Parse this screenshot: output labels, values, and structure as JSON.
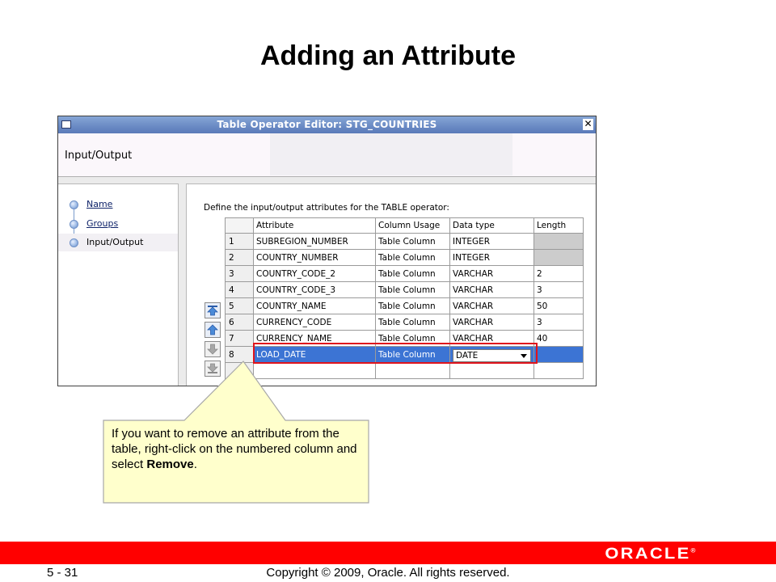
{
  "slide": {
    "title": "Adding an Attribute"
  },
  "window": {
    "title": "Table Operator Editor: STG_COUNTRIES",
    "close_glyph": "✕",
    "header_title": "Input/Output"
  },
  "nav": {
    "items": [
      {
        "label": "Name",
        "active": false
      },
      {
        "label": "Groups",
        "active": false
      },
      {
        "label": "Input/Output",
        "active": true
      }
    ]
  },
  "content": {
    "instruction": "Define the input/output attributes for the TABLE operator:",
    "columns": [
      "Attribute",
      "Column Usage",
      "Data type",
      "Length"
    ],
    "rows": [
      {
        "num": "1",
        "attribute": "SUBREGION_NUMBER",
        "usage": "Table Column",
        "type": "INTEGER",
        "length": ""
      },
      {
        "num": "2",
        "attribute": "COUNTRY_NUMBER",
        "usage": "Table Column",
        "type": "INTEGER",
        "length": ""
      },
      {
        "num": "3",
        "attribute": "COUNTRY_CODE_2",
        "usage": "Table Column",
        "type": "VARCHAR",
        "length": "2"
      },
      {
        "num": "4",
        "attribute": "COUNTRY_CODE_3",
        "usage": "Table Column",
        "type": "VARCHAR",
        "length": "3"
      },
      {
        "num": "5",
        "attribute": "COUNTRY_NAME",
        "usage": "Table Column",
        "type": "VARCHAR",
        "length": "50"
      },
      {
        "num": "6",
        "attribute": "CURRENCY_CODE",
        "usage": "Table Column",
        "type": "VARCHAR",
        "length": "3"
      },
      {
        "num": "7",
        "attribute": "CURRENCY_NAME",
        "usage": "Table Column",
        "type": "VARCHAR",
        "length": "40"
      },
      {
        "num": "8",
        "attribute": "LOAD_DATE",
        "usage": "Table Column",
        "type": "DATE",
        "length": ""
      }
    ],
    "selected_row": "8"
  },
  "callout": {
    "text_before": "If you want to remove an attribute from the table, right-click on the numbered column and select ",
    "bold_word": "Remove",
    "text_after": "."
  },
  "footer": {
    "page": "5 - 31",
    "copyright": "Copyright © 2009, Oracle. All rights reserved.",
    "logo_text": "ORACLE",
    "logo_mark": "®"
  },
  "colors": {
    "footer_bar": "#ff0000",
    "selection": "#3c74d4",
    "highlight_box": "#e0141c",
    "callout_fill": "#ffffcc"
  }
}
